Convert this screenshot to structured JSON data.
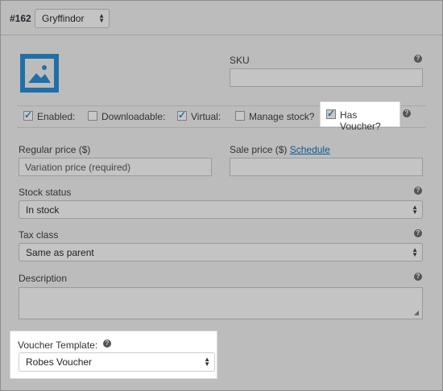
{
  "variation": {
    "number": "#162",
    "attribute_value": "Gryffindor"
  },
  "image": {
    "icon": "image-placeholder-icon"
  },
  "sku": {
    "label": "SKU",
    "value": ""
  },
  "options": [
    {
      "label": "Enabled:",
      "checked": true
    },
    {
      "label": "Downloadable:",
      "checked": false
    },
    {
      "label": "Virtual:",
      "checked": true
    },
    {
      "label": "Manage stock?",
      "checked": false
    },
    {
      "label": "Has Voucher?",
      "checked": true
    }
  ],
  "regular_price": {
    "label": "Regular price ($)",
    "placeholder": "Variation price (required)"
  },
  "sale_price": {
    "label": "Sale price ($)",
    "schedule_link": "Schedule"
  },
  "stock_status": {
    "label": "Stock status",
    "value": "In stock"
  },
  "tax_class": {
    "label": "Tax class",
    "value": "Same as parent"
  },
  "description": {
    "label": "Description",
    "value": ""
  },
  "voucher_template": {
    "label": "Voucher Template:",
    "value": "Robes Voucher"
  },
  "colors": {
    "accent": "#1f70a8",
    "link": "#0a5b91",
    "overlay": "#bcbcbc"
  }
}
